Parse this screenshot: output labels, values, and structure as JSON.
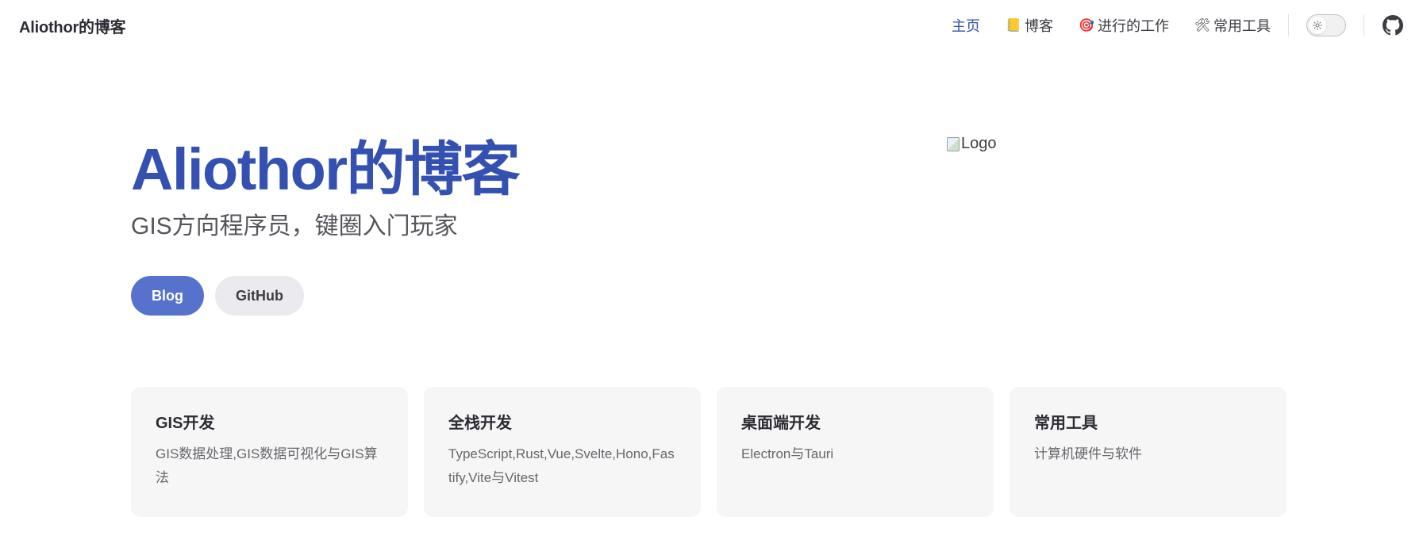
{
  "header": {
    "site_title": "Aliothor的博客",
    "nav": [
      {
        "label": "主页",
        "emoji": "",
        "active": true
      },
      {
        "label": "博客",
        "emoji": "📒",
        "active": false
      },
      {
        "label": "进行的工作",
        "emoji": "🎯",
        "active": false
      },
      {
        "label": "常用工具",
        "emoji": "🛠",
        "active": false
      }
    ],
    "theme_toggle_icon": "sun-icon",
    "github_icon": "github-icon"
  },
  "hero": {
    "name": "Aliothor的博客",
    "tagline": "GIS方向程序员，键圈入门玩家",
    "actions": [
      {
        "label": "Blog",
        "style": "brand"
      },
      {
        "label": "GitHub",
        "style": "alt"
      }
    ],
    "image_alt": "Logo"
  },
  "features": [
    {
      "title": "GIS开发",
      "details": "GIS数据处理,GIS数据可视化与GIS算法"
    },
    {
      "title": "全栈开发",
      "details": "TypeScript,Rust,Vue,Svelte,Hono,Fastify,Vite与Vitest"
    },
    {
      "title": "桌面端开发",
      "details": "Electron与Tauri"
    },
    {
      "title": "常用工具",
      "details": "计算机硬件与软件"
    }
  ],
  "colors": {
    "brand": "#3451b2",
    "brand_button": "#5672cd",
    "alt_button": "#ebebef",
    "feature_bg": "#f6f6f7"
  }
}
